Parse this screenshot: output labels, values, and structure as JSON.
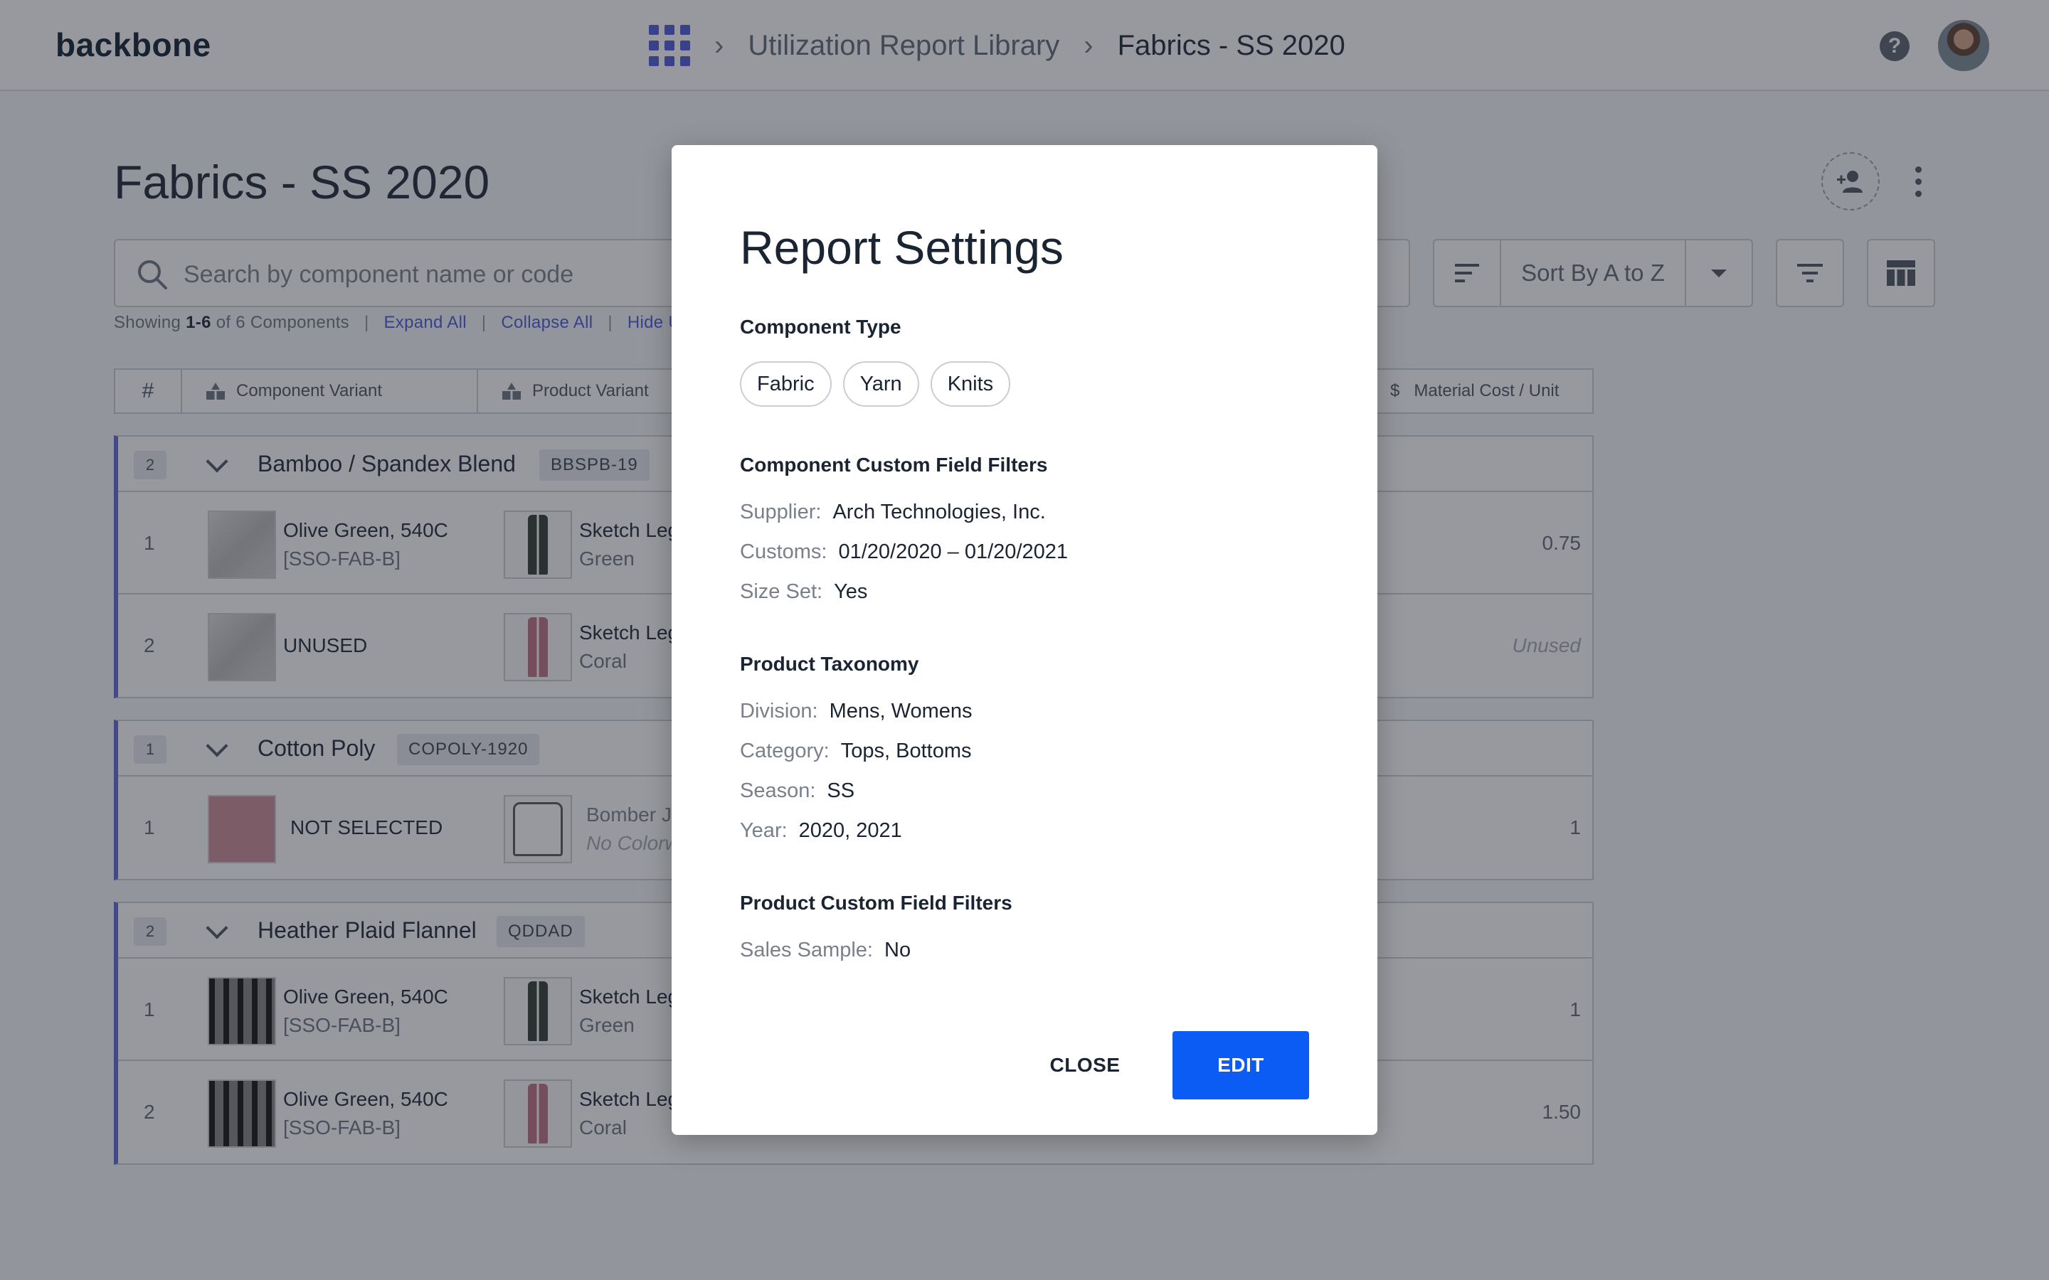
{
  "app": {
    "logo": "backbone"
  },
  "breadcrumb": {
    "items": [
      "Utilization Report Library",
      "Fabrics - SS 2020"
    ]
  },
  "page": {
    "title": "Fabrics - SS 2020"
  },
  "search": {
    "placeholder": "Search by component name or code"
  },
  "sort": {
    "label": "Sort By A to Z"
  },
  "summary": {
    "showing_prefix": "Showing ",
    "range": "1-6",
    "of_text": " of 6 Components",
    "expand_all": "Expand All",
    "collapse_all": "Collapse All",
    "hide_partial": "Hide U"
  },
  "table": {
    "headers": {
      "num": "#",
      "component_variant": "Component Variant",
      "product_variant": "Product Variant",
      "material_cost": "Material Cost / Unit"
    },
    "groups": [
      {
        "count": "2",
        "name": "Bamboo / Spandex Blend",
        "code": "BBSPB-19",
        "rows": [
          {
            "index": "1",
            "cv_name": "Olive Green, 540C",
            "cv_code": "[SSO-FAB-B]",
            "pv_name": "Sketch Leg",
            "pv_color": "Green",
            "cost": "0.75"
          },
          {
            "index": "2",
            "cv_name": "UNUSED",
            "cv_code": "",
            "pv_name": "Sketch Leg",
            "pv_color": "Coral",
            "cost": "Unused"
          }
        ]
      },
      {
        "count": "1",
        "name": "Cotton Poly",
        "code": "COPOLY-1920",
        "rows": [
          {
            "index": "1",
            "cv_name": "NOT SELECTED",
            "cv_code": "",
            "pv_name": "Bomber Ja",
            "pv_color": "No Colorw",
            "cost": "1"
          }
        ]
      },
      {
        "count": "2",
        "name": "Heather Plaid Flannel",
        "code": "QDDAD",
        "rows": [
          {
            "index": "1",
            "cv_name": "Olive Green, 540C",
            "cv_code": "[SSO-FAB-B]",
            "pv_name": "Sketch Leg",
            "pv_color": "Green",
            "cost": "1"
          },
          {
            "index": "2",
            "cv_name": "Olive Green, 540C",
            "cv_code": "[SSO-FAB-B]",
            "pv_name": "Sketch Leg",
            "pv_color": "Coral",
            "cost": "1.50"
          }
        ]
      }
    ]
  },
  "modal": {
    "title": "Report Settings",
    "component_type": {
      "heading": "Component Type",
      "chips": [
        "Fabric",
        "Yarn",
        "Knits"
      ]
    },
    "component_custom": {
      "heading": "Component Custom Field Filters",
      "fields": [
        {
          "label": "Supplier:",
          "value": "Arch Technologies, Inc."
        },
        {
          "label": "Customs:",
          "value": "01/20/2020 – 01/20/2021"
        },
        {
          "label": "Size Set:",
          "value": "Yes"
        }
      ]
    },
    "product_taxonomy": {
      "heading": "Product Taxonomy",
      "fields": [
        {
          "label": "Division:",
          "value": "Mens, Womens"
        },
        {
          "label": "Category:",
          "value": "Tops, Bottoms"
        },
        {
          "label": "Season:",
          "value": "SS"
        },
        {
          "label": "Year:",
          "value": "2020, 2021"
        }
      ]
    },
    "product_custom": {
      "heading": "Product Custom Field Filters",
      "fields": [
        {
          "label": "Sales Sample:",
          "value": "No"
        }
      ]
    },
    "close_label": "CLOSE",
    "edit_label": "EDIT"
  },
  "icons": {
    "apps": "grid-apps-icon",
    "chevron": "chevron-right-icon",
    "help": "help-icon",
    "search": "search-icon",
    "sort": "sort-lines-icon",
    "filter": "filter-icon",
    "columns": "table-columns-icon",
    "share": "add-person-icon",
    "more": "more-vertical-icon"
  },
  "colors": {
    "accent": "#4a56d8",
    "primary_button": "#0a5cf5",
    "group_bar": "#5c66d6"
  }
}
